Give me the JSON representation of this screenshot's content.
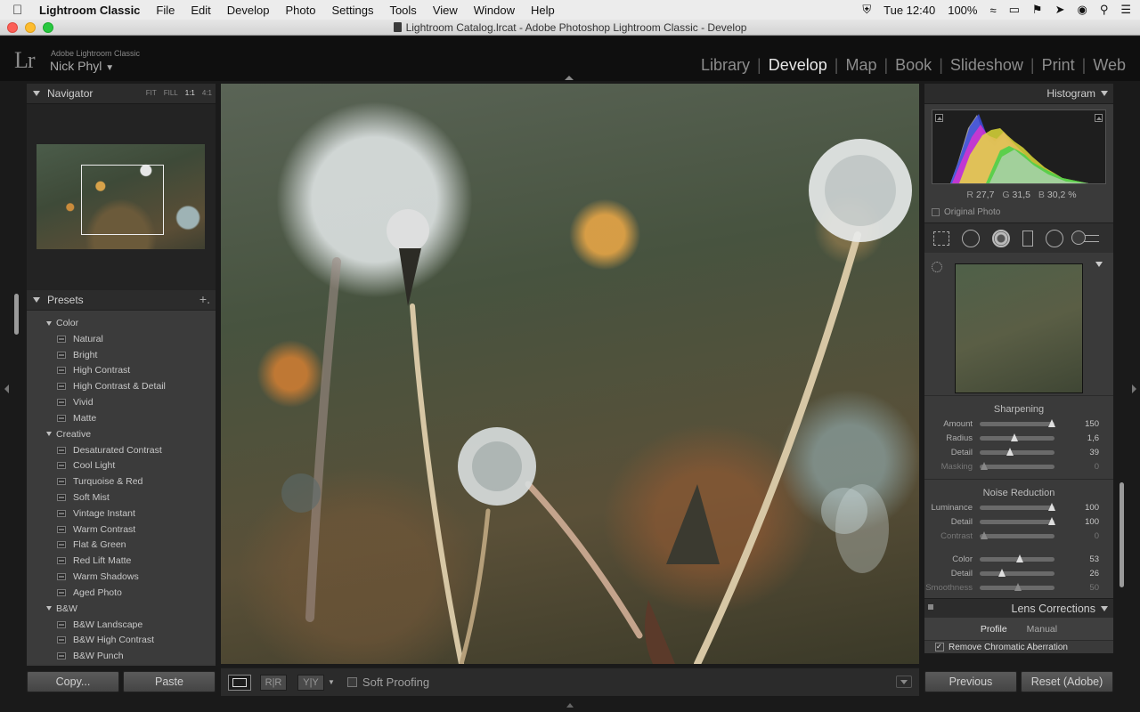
{
  "menubar": {
    "app": "Lightroom Classic",
    "items": [
      "File",
      "Edit",
      "Develop",
      "Photo",
      "Settings",
      "Tools",
      "View",
      "Window",
      "Help"
    ],
    "clock": "Tue 12:40",
    "battery": "100%"
  },
  "window": {
    "title": "Lightroom Catalog.lrcat - Adobe Photoshop Lightroom Classic - Develop"
  },
  "identity": {
    "logo": "Lr",
    "app_name": "Adobe Lightroom Classic",
    "user": "Nick Phyl",
    "modules": [
      "Library",
      "Develop",
      "Map",
      "Book",
      "Slideshow",
      "Print",
      "Web"
    ],
    "active_module": "Develop"
  },
  "navigator": {
    "title": "Navigator",
    "zoom_options": [
      "FIT",
      "FILL",
      "1:1",
      "4:1"
    ],
    "active_zoom": "1:1"
  },
  "presets": {
    "title": "Presets",
    "add_label": "+.",
    "groups": [
      {
        "name": "Color",
        "items": [
          "Natural",
          "Bright",
          "High Contrast",
          "High Contrast & Detail",
          "Vivid",
          "Matte"
        ]
      },
      {
        "name": "Creative",
        "items": [
          "Desaturated Contrast",
          "Cool Light",
          "Turquoise & Red",
          "Soft Mist",
          "Vintage Instant",
          "Warm Contrast",
          "Flat & Green",
          "Red Lift Matte",
          "Warm Shadows",
          "Aged Photo"
        ]
      },
      {
        "name": "B&W",
        "items": [
          "B&W Landscape",
          "B&W High Contrast",
          "B&W Punch"
        ]
      }
    ]
  },
  "left_buttons": {
    "copy": "Copy...",
    "paste": "Paste"
  },
  "toolbar": {
    "rr": "R|R",
    "yy": "Y|Y",
    "soft_proofing": "Soft Proofing"
  },
  "histogram": {
    "title": "Histogram",
    "r_label": "R",
    "r_value": "27,7",
    "g_label": "G",
    "g_value": "31,5",
    "b_label": "B",
    "b_value": "30,2",
    "unit": "%",
    "original_photo": "Original Photo"
  },
  "sharpening": {
    "title": "Sharpening",
    "sliders": [
      {
        "label": "Amount",
        "value": "150",
        "fraction": 0.96
      },
      {
        "label": "Radius",
        "value": "1,6",
        "fraction": 0.46
      },
      {
        "label": "Detail",
        "value": "39",
        "fraction": 0.41
      },
      {
        "label": "Masking",
        "value": "0",
        "fraction": 0.06
      }
    ]
  },
  "noise_reduction": {
    "title": "Noise Reduction",
    "sliders": [
      {
        "label": "Luminance",
        "value": "100",
        "fraction": 0.96
      },
      {
        "label": "Detail",
        "value": "100",
        "fraction": 0.96
      },
      {
        "label": "Contrast",
        "value": "0",
        "fraction": 0.06
      },
      {
        "label": "Color",
        "value": "53",
        "fraction": 0.53
      },
      {
        "label": "Detail",
        "value": "26",
        "fraction": 0.3
      },
      {
        "label": "Smoothness",
        "value": "50",
        "fraction": 0.51
      }
    ]
  },
  "lens_corrections": {
    "title": "Lens Corrections",
    "tabs": [
      "Profile",
      "Manual"
    ],
    "active_tab": "Profile",
    "checkbox": "Remove Chromatic Aberration"
  },
  "right_buttons": {
    "previous": "Previous",
    "reset": "Reset (Adobe)"
  }
}
